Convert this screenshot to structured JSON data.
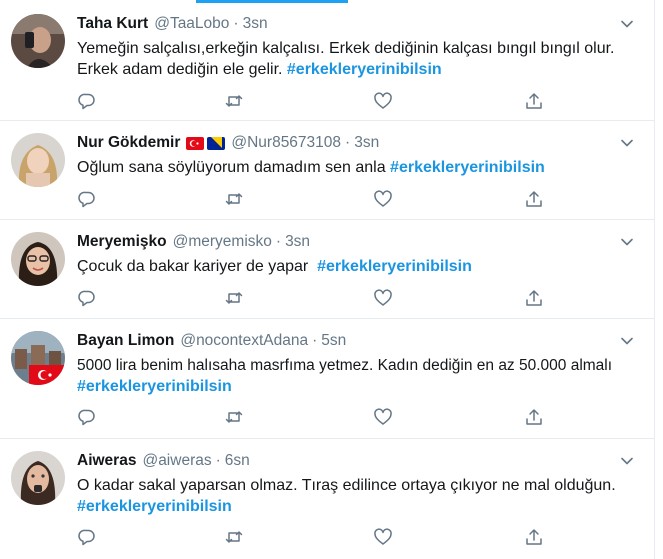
{
  "tweets": [
    {
      "name": "Taha Kurt",
      "handle": "@TaaLobo",
      "separator": "·",
      "time": "3sn",
      "text_line1": "Yemeğin salçalısı,erkeğin kalçalısı. Erkek dediğinin kalçası bıngıl bıngıl olur.",
      "text_line2_prefix": "Erkek adam dediğin ele gelir. ",
      "hashtag": "#erkekleryerinibilsin"
    },
    {
      "name": "Nur Gökdemir",
      "flags": [
        "turkey-flag-icon",
        "bosnia-flag-icon"
      ],
      "handle": "@Nur85673108",
      "separator": "·",
      "time": "3sn",
      "text_line1_prefix": "Oğlum sana söylüyorum damadım sen anla ",
      "hashtag": "#erkekleryerinibilsin"
    },
    {
      "name": "Meryemişko",
      "handle": "@meryemisko",
      "separator": "·",
      "time": "3sn",
      "text_line1_prefix": "Çocuk da bakar kariyer de yapar  ",
      "hashtag": "#erkekleryerinibilsin"
    },
    {
      "name": "Bayan Limon",
      "handle": "@nocontextAdana",
      "separator": "·",
      "time": "5sn",
      "text_line1": "5000 lira benim halısaha masrfıma yetmez. Kadın dediğin en az 50.000 almalı",
      "hashtag": "#erkekleryerinibilsin"
    },
    {
      "name": "Aiweras",
      "handle": "@aiweras",
      "separator": "·",
      "time": "6sn",
      "text_line1": "O kadar sakal yaparsan olmaz. Tıraş edilince ortaya çıkıyor ne mal olduğun.",
      "hashtag": "#erkekleryerinibilsin"
    }
  ],
  "actions": [
    "reply-icon",
    "retweet-icon",
    "like-icon",
    "share-icon"
  ],
  "colors": {
    "accent": "#1da1f2",
    "hashtag": "#1b95e0",
    "secondary_text": "#657786",
    "divider": "#e6ecf0"
  }
}
